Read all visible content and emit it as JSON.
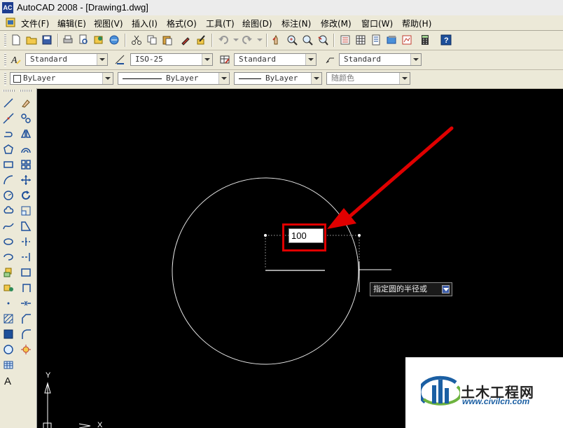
{
  "window": {
    "title": "AutoCAD 2008 - [Drawing1.dwg]",
    "app_icon_text": "AC"
  },
  "menu": [
    "文件(F)",
    "编辑(E)",
    "视图(V)",
    "插入(I)",
    "格式(O)",
    "工具(T)",
    "绘图(D)",
    "标注(N)",
    "修改(M)",
    "窗口(W)",
    "帮助(H)"
  ],
  "styles_toolbar": {
    "text_style": "Standard",
    "dim_style": "ISO-25",
    "table_style": "Standard",
    "multileader_style": "Standard"
  },
  "properties_toolbar": {
    "color": "ByLayer",
    "linetype": "ByLayer",
    "lineweight": "ByLayer",
    "plot_style": "随颜色"
  },
  "canvas": {
    "radius_input_value": "100",
    "prompt_tooltip": "指定圆的半径或",
    "ucs_y_label": "Y",
    "ucs_x_label": "X",
    "background": "#000000",
    "highlight_color": "#e00000"
  },
  "watermark": {
    "title": "土木工程网",
    "url": "www.civilcn.com"
  },
  "standard_toolbar_icons": [
    "new-icon",
    "open-icon",
    "save-icon",
    "print-icon",
    "plot-preview-icon",
    "publish-icon",
    "3d-dwf-icon",
    "cut-icon",
    "copy-icon",
    "paste-icon",
    "match-properties-icon",
    "block-editor-icon",
    "undo-icon",
    "redo-icon",
    "pan-icon",
    "zoom-realtime-icon",
    "zoom-window-icon",
    "zoom-previous-icon",
    "properties-icon",
    "design-center-icon",
    "tool-palettes-icon",
    "sheet-set-icon",
    "markup-icon",
    "quickcalc-icon",
    "help-icon"
  ],
  "draw_toolbar_icons": [
    "line-icon",
    "construction-line-icon",
    "polyline-icon",
    "polygon-icon",
    "rectangle-icon",
    "arc-icon",
    "circle-icon",
    "revision-cloud-icon",
    "spline-icon",
    "ellipse-icon",
    "ellipse-arc-icon",
    "insert-block-icon",
    "make-block-icon",
    "point-icon",
    "hatch-icon",
    "gradient-icon",
    "region-icon",
    "table-icon",
    "multiline-text-icon"
  ],
  "modify_toolbar_icons": [
    "erase-icon",
    "copy-object-icon",
    "mirror-icon",
    "offset-icon",
    "array-icon",
    "move-icon",
    "rotate-icon",
    "scale-icon",
    "stretch-icon",
    "trim-icon",
    "extend-icon",
    "break-at-point-icon",
    "break-icon",
    "join-icon",
    "chamfer-icon",
    "fillet-icon",
    "explode-icon"
  ]
}
